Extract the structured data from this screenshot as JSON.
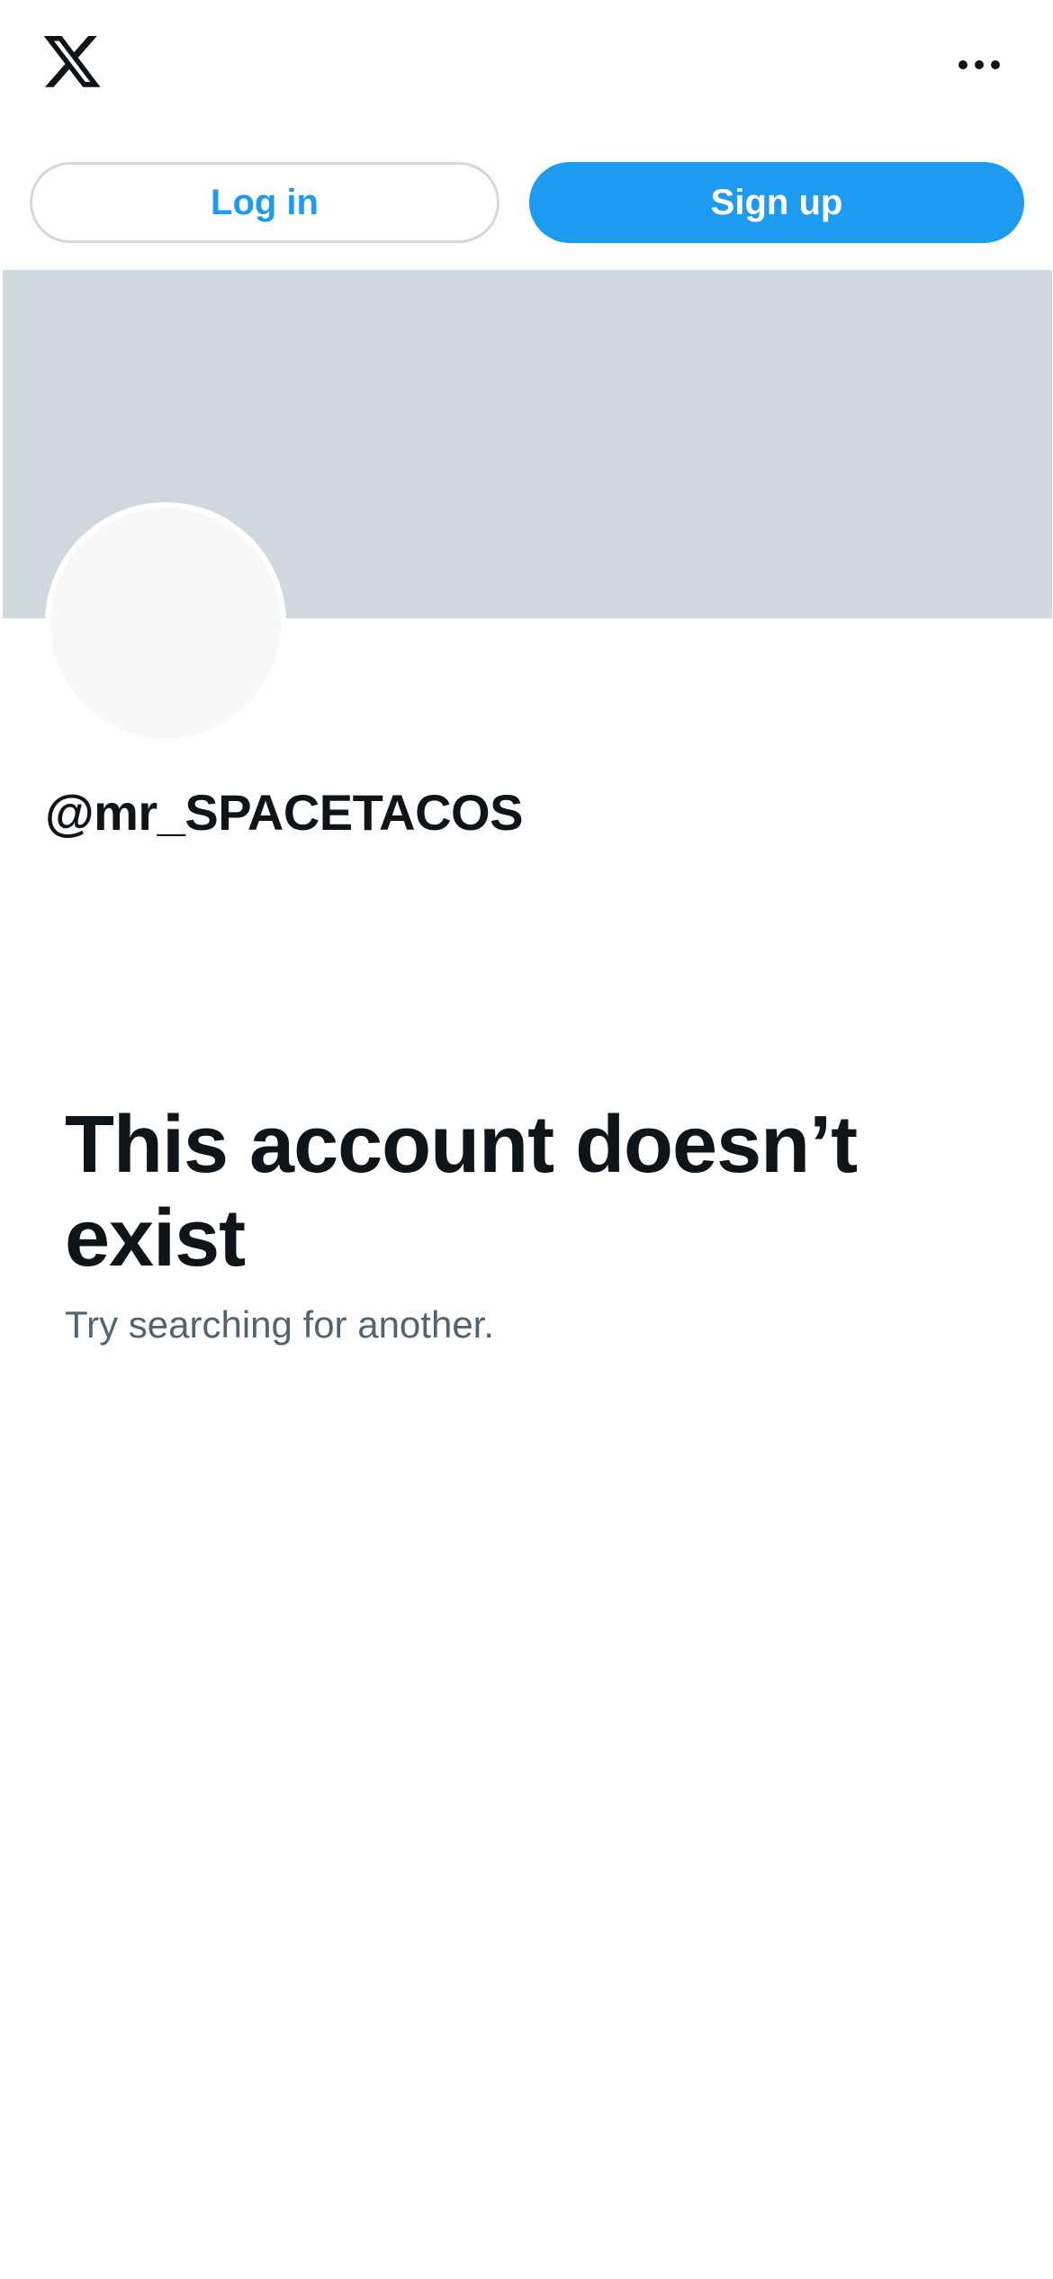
{
  "header": {
    "logo_icon": "x-logo-icon",
    "more_icon": "more-horizontal-icon"
  },
  "auth": {
    "login_label": "Log in",
    "signup_label": "Sign up"
  },
  "profile": {
    "handle": "@mr_SPACETACOS"
  },
  "empty_state": {
    "title": "This account doesn’t exist",
    "subtitle": "Try searching for another."
  },
  "colors": {
    "accent": "#1d9bf0",
    "banner": "#cfd9de",
    "text_primary": "#0f1419",
    "text_secondary": "#536471",
    "avatar_bg": "#f7f9f9"
  }
}
